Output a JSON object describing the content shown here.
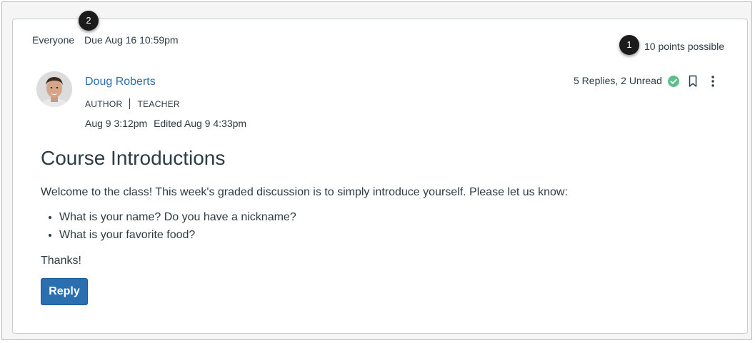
{
  "header": {
    "audience": "Everyone",
    "due": "Due Aug 16 10:59pm",
    "points": "10 points possible"
  },
  "callouts": [
    "1",
    "2"
  ],
  "author": {
    "name": "Doug Roberts",
    "role_primary": "AUTHOR",
    "role_secondary": "TEACHER",
    "posted": "Aug 9 3:12pm",
    "edited": "Edited Aug 9 4:33pm"
  },
  "status": {
    "replies": "5 Replies, 2 Unread"
  },
  "icons": {
    "check": "published-check-icon",
    "bookmark": "bookmark-icon",
    "menu": "kebab-menu-icon"
  },
  "post": {
    "title": "Course Introductions",
    "intro": "Welcome to the class! This week's graded discussion is to simply introduce yourself. Please let us know:",
    "bullets": [
      "What is your name? Do you have a nickname?",
      "What is your favorite food?"
    ],
    "closing": "Thanks!"
  },
  "actions": {
    "reply_label": "Reply"
  },
  "colors": {
    "accent": "#2b6fb0",
    "check": "#5fbf8a",
    "text": "#2d3b45"
  }
}
